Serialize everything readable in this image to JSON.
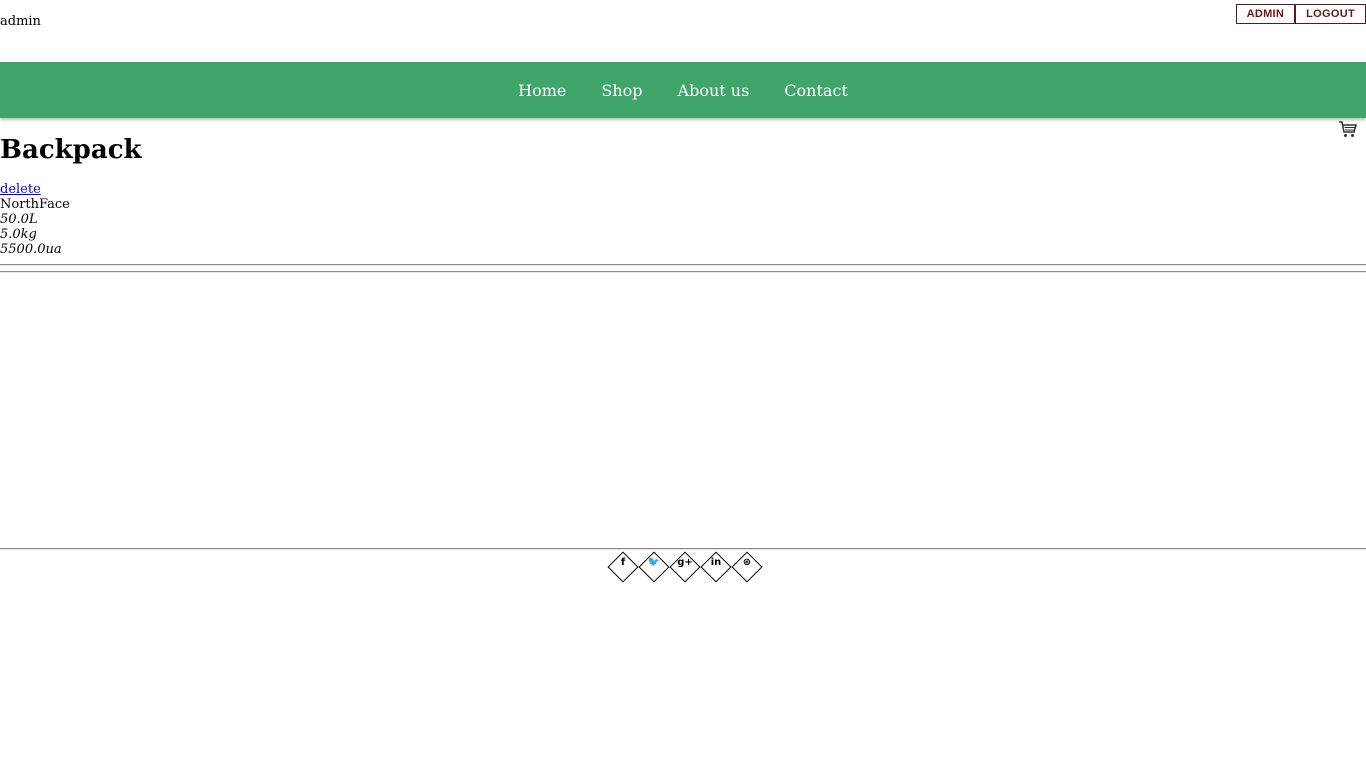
{
  "header": {
    "username": "admin",
    "admin_label": "ADMIN",
    "logout_label": "LOGOUT"
  },
  "nav": {
    "items": [
      {
        "label": "Home"
      },
      {
        "label": "Shop"
      },
      {
        "label": "About us"
      },
      {
        "label": "Contact"
      }
    ]
  },
  "cart": {
    "icon": "shopping-cart-icon"
  },
  "product": {
    "name": "Backpack",
    "delete_label": "delete",
    "brand": "NorthFace",
    "volume": "50.0L",
    "weight": "5.0kg",
    "price": "5500.0ua"
  },
  "footer": {
    "social": [
      {
        "icon": "facebook-icon",
        "glyph": "f"
      },
      {
        "icon": "twitter-icon",
        "glyph": "🐦"
      },
      {
        "icon": "google-plus-icon",
        "glyph": "g+"
      },
      {
        "icon": "linkedin-icon",
        "glyph": "in"
      },
      {
        "icon": "dribbble-icon",
        "glyph": "⊛"
      }
    ]
  }
}
